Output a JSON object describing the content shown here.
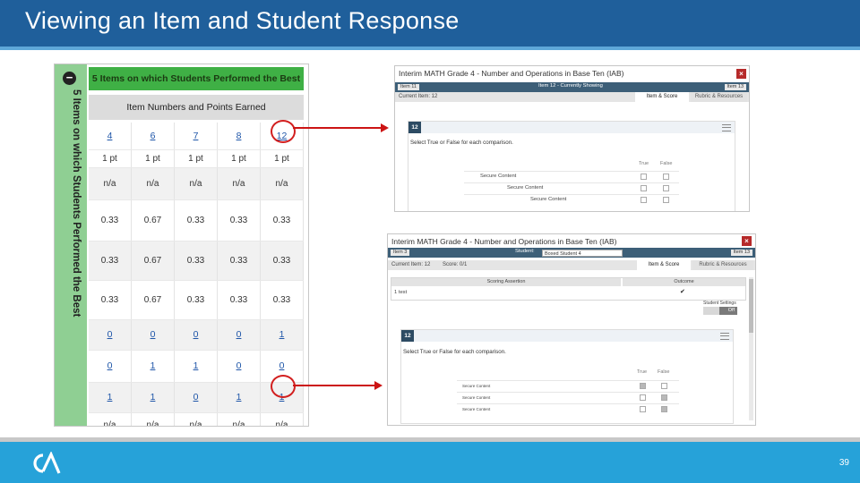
{
  "slide": {
    "title": "Viewing an Item and Student Response",
    "page_number": "39",
    "colors": {
      "title_bar": "#1f5f9b",
      "footer_bar": "#26a2d9",
      "annotation": "#cc1414",
      "green_header": "#3fb045"
    }
  },
  "table_panel": {
    "vertical_title": "5 Items on which Students Performed the Best",
    "header": "5 Items on which Students Performed the Best",
    "subheader": "Item Numbers and Points Earned",
    "collapse_icon": "minus-circle-icon",
    "rows": [
      [
        "4",
        "6",
        "7",
        "8",
        "12"
      ],
      [
        "1 pt",
        "1 pt",
        "1 pt",
        "1 pt",
        "1 pt"
      ],
      [
        "n/a",
        "n/a",
        "n/a",
        "n/a",
        "n/a"
      ],
      [
        "0.33",
        "0.67",
        "0.33",
        "0.33",
        "0.33"
      ],
      [
        "0.33",
        "0.67",
        "0.33",
        "0.33",
        "0.33"
      ],
      [
        "0.33",
        "0.67",
        "0.33",
        "0.33",
        "0.33"
      ],
      [
        "0",
        "0",
        "0",
        "0",
        "1"
      ],
      [
        "0",
        "1",
        "1",
        "0",
        "0"
      ],
      [
        "1",
        "1",
        "0",
        "1",
        "1"
      ],
      [
        "n/a",
        "n/a",
        "n/a",
        "n/a",
        "n/a"
      ]
    ]
  },
  "item_view": {
    "title": "Interim MATH Grade 4 - Number and Operations in Base Ten (IAB)",
    "prev_item": "Item 11",
    "center_label": "Item 12 - Currently Showing",
    "next_item": "Item 13",
    "current_item": "Current Item: 12",
    "tab_active": "Item & Score",
    "tab_inactive": "Rubric & Resources",
    "item_number": "12",
    "prompt": "Select True or False for each comparison.",
    "col_true": "True",
    "col_false": "False",
    "rows": [
      "Secure Content",
      "Secure Content",
      "Secure Content"
    ]
  },
  "student_view": {
    "title": "Interim MATH Grade 4 - Number and Operations in Base Ten (IAB)",
    "prev_item": "Item 3",
    "student_label": "Student:",
    "student_value": "Boxed Student 4",
    "next_item": "Item 13",
    "current_item": "Current Item: 12",
    "score": "Score: 0/1",
    "tab_active": "Item & Score",
    "tab_inactive": "Rubric & Resources",
    "col_assertion": "Scoring Assertion",
    "col_outcome": "Outcome",
    "assertion_row": "1 test",
    "outcome_icon": "checkmark-icon",
    "settings_label": "Student Settings",
    "settings_toggle": "Off",
    "item_number": "12",
    "prompt": "Select True or False for each comparison.",
    "col_true": "True",
    "col_false": "False",
    "rows": [
      "Secure Content",
      "Secure Content",
      "Secure Content"
    ]
  }
}
